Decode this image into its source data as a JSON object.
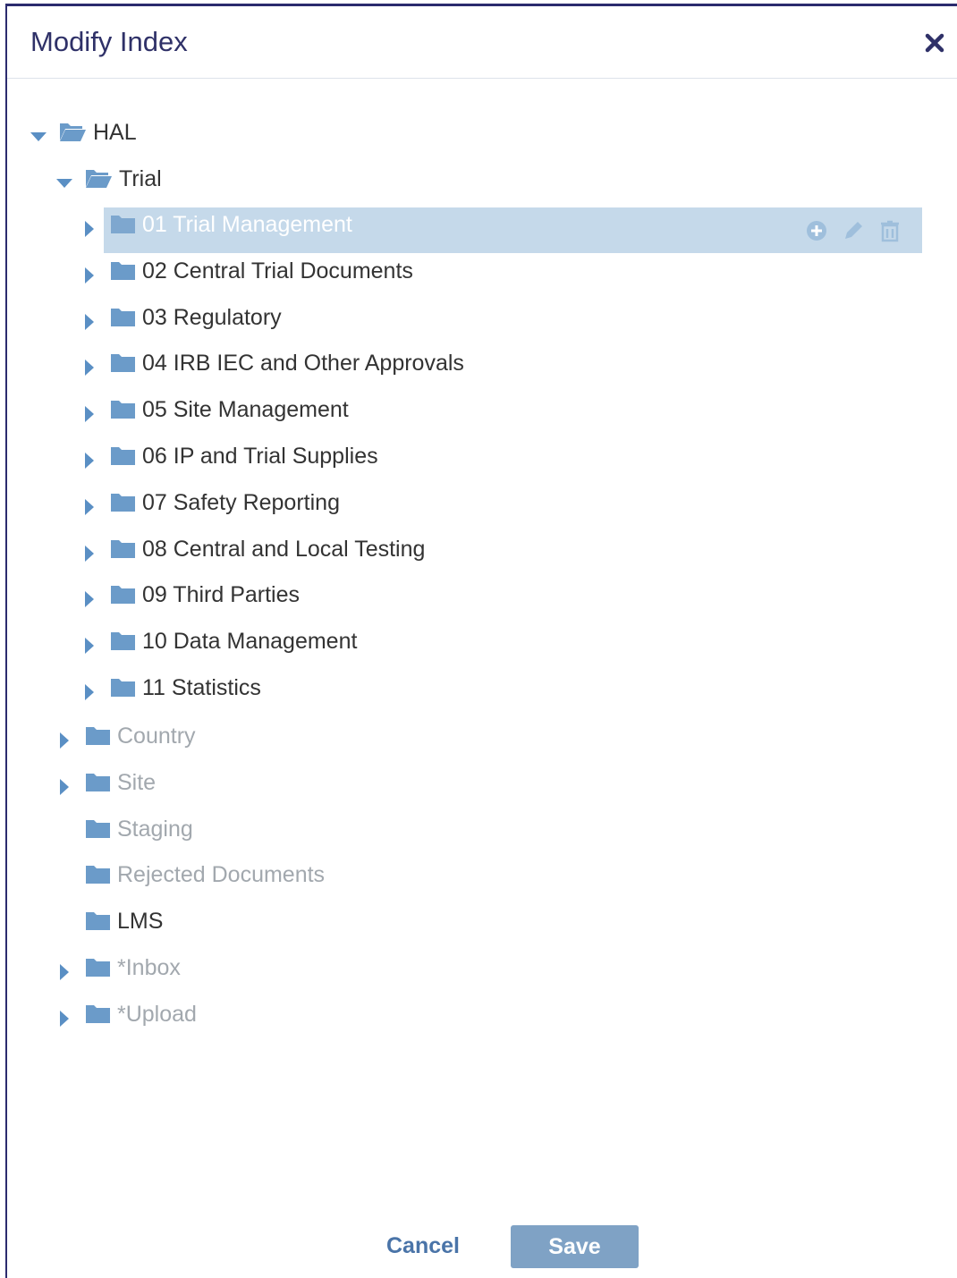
{
  "dialog": {
    "title": "Modify Index",
    "close_icon": "close-icon"
  },
  "tree": {
    "root": {
      "label": "HAL",
      "expanded": true,
      "icon": "folder-open-icon"
    },
    "trial": {
      "label": "Trial",
      "expanded": true,
      "icon": "folder-open-icon"
    },
    "trial_children": [
      {
        "label": "01 Trial Management",
        "selected": true
      },
      {
        "label": "02 Central Trial Documents"
      },
      {
        "label": "03 Regulatory"
      },
      {
        "label": "04 IRB IEC and Other Approvals"
      },
      {
        "label": "05 Site Management"
      },
      {
        "label": "06 IP and Trial Supplies"
      },
      {
        "label": "07 Safety Reporting"
      },
      {
        "label": "08 Central and Local Testing"
      },
      {
        "label": "09 Third Parties"
      },
      {
        "label": "10 Data Management"
      },
      {
        "label": "11 Statistics"
      }
    ],
    "root_children": [
      {
        "label": "Country",
        "expandable": true,
        "muted": true
      },
      {
        "label": "Site",
        "expandable": true,
        "muted": true
      },
      {
        "label": "Staging",
        "expandable": false,
        "muted": true
      },
      {
        "label": "Rejected Documents",
        "expandable": false,
        "muted": true
      },
      {
        "label": "LMS",
        "expandable": false,
        "muted": false
      },
      {
        "label": "*Inbox",
        "expandable": true,
        "muted": true
      },
      {
        "label": "*Upload",
        "expandable": true,
        "muted": true
      }
    ],
    "selected_actions": [
      "add-circle-icon",
      "pencil-icon",
      "trash-icon"
    ]
  },
  "footer": {
    "cancel_label": "Cancel",
    "save_label": "Save"
  },
  "colors": {
    "title": "#2f3168",
    "folder": "#6b9bc9",
    "caret": "#5a8fc4",
    "selection": "#c5d9ea",
    "save_button": "#7fa2c5",
    "muted_text": "#a2a8ae"
  }
}
